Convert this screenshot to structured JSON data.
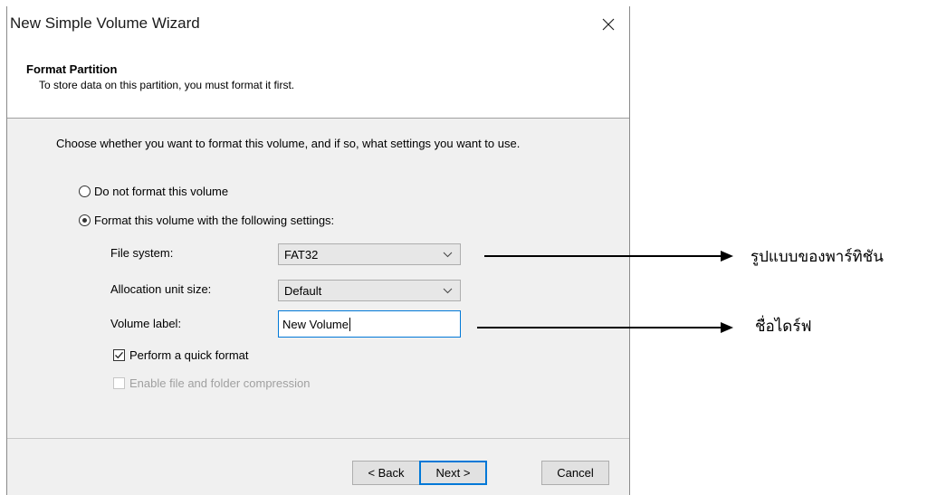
{
  "window": {
    "title": "New Simple Volume Wizard",
    "close_symbol": "✕"
  },
  "header": {
    "title": "Format Partition",
    "subtitle": "To store data on this partition, you must format it first."
  },
  "intro": "Choose whether you want to format this volume, and if so, what settings you want to use.",
  "options": {
    "no_format": {
      "label": "Do not format this volume",
      "selected": false
    },
    "format": {
      "label": "Format this volume with the following settings:",
      "selected": true
    }
  },
  "settings": {
    "file_system": {
      "label": "File system:",
      "value": "FAT32"
    },
    "allocation_unit": {
      "label": "Allocation unit size:",
      "value": "Default"
    },
    "volume_label": {
      "label": "Volume label:",
      "value": "New Volume"
    }
  },
  "checks": {
    "quick_format": {
      "label": "Perform a quick format",
      "checked": true,
      "enabled": true
    },
    "compression": {
      "label": "Enable file and folder compression",
      "checked": false,
      "enabled": false
    }
  },
  "buttons": {
    "back": "< Back",
    "next": "Next >",
    "cancel": "Cancel"
  },
  "annotations": {
    "file_system_note": "รูปแบบของพาร์ทิชัน",
    "volume_label_note": "ชื่อไดร์ฟ"
  },
  "colors": {
    "accent": "#0078d7",
    "dialog_bg": "#f0f0f0",
    "button_bg": "#e1e1e1"
  },
  "icons": {
    "close": "close-icon",
    "dropdown": "chevron-down-icon",
    "check": "checkmark-icon",
    "arrow": "arrow-right-icon"
  }
}
